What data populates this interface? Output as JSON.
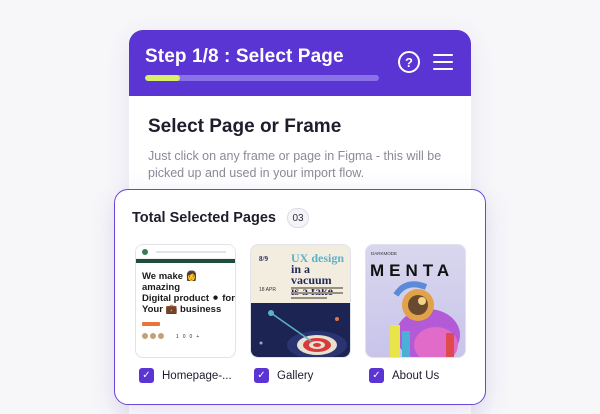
{
  "header": {
    "title": "Step 1/8 : Select Page",
    "progress": 0.15,
    "help_icon_glyph": "?"
  },
  "body": {
    "title": "Select Page or Frame",
    "description": "Just click on any frame or page in Figma - this will be picked up and used in your import flow."
  },
  "selected": {
    "title": "Total Selected Pages",
    "count": "03",
    "check_glyph": "✓",
    "pages": [
      {
        "label": "Homepage-...",
        "checked": true,
        "thumb": {
          "hero_line1": "We make 👩 amazing",
          "hero_line2": "Digital product ⚫ for",
          "hero_line3": "Your 💼 business",
          "stats": "100+"
        }
      },
      {
        "label": "Gallery",
        "checked": true,
        "thumb": {
          "num": "8/9",
          "head_line1": "UX design",
          "head_line2": "in a vacuum",
          "head_line3": "is a fake",
          "small": "18 APR"
        }
      },
      {
        "label": "About Us",
        "checked": true,
        "thumb": {
          "small": "DARKMODE",
          "brand": "MENTA"
        }
      }
    ]
  },
  "colors": {
    "accent": "#5b34d4",
    "progress_fill": "#d9ef6c",
    "selection_border": "#6b45d8"
  }
}
